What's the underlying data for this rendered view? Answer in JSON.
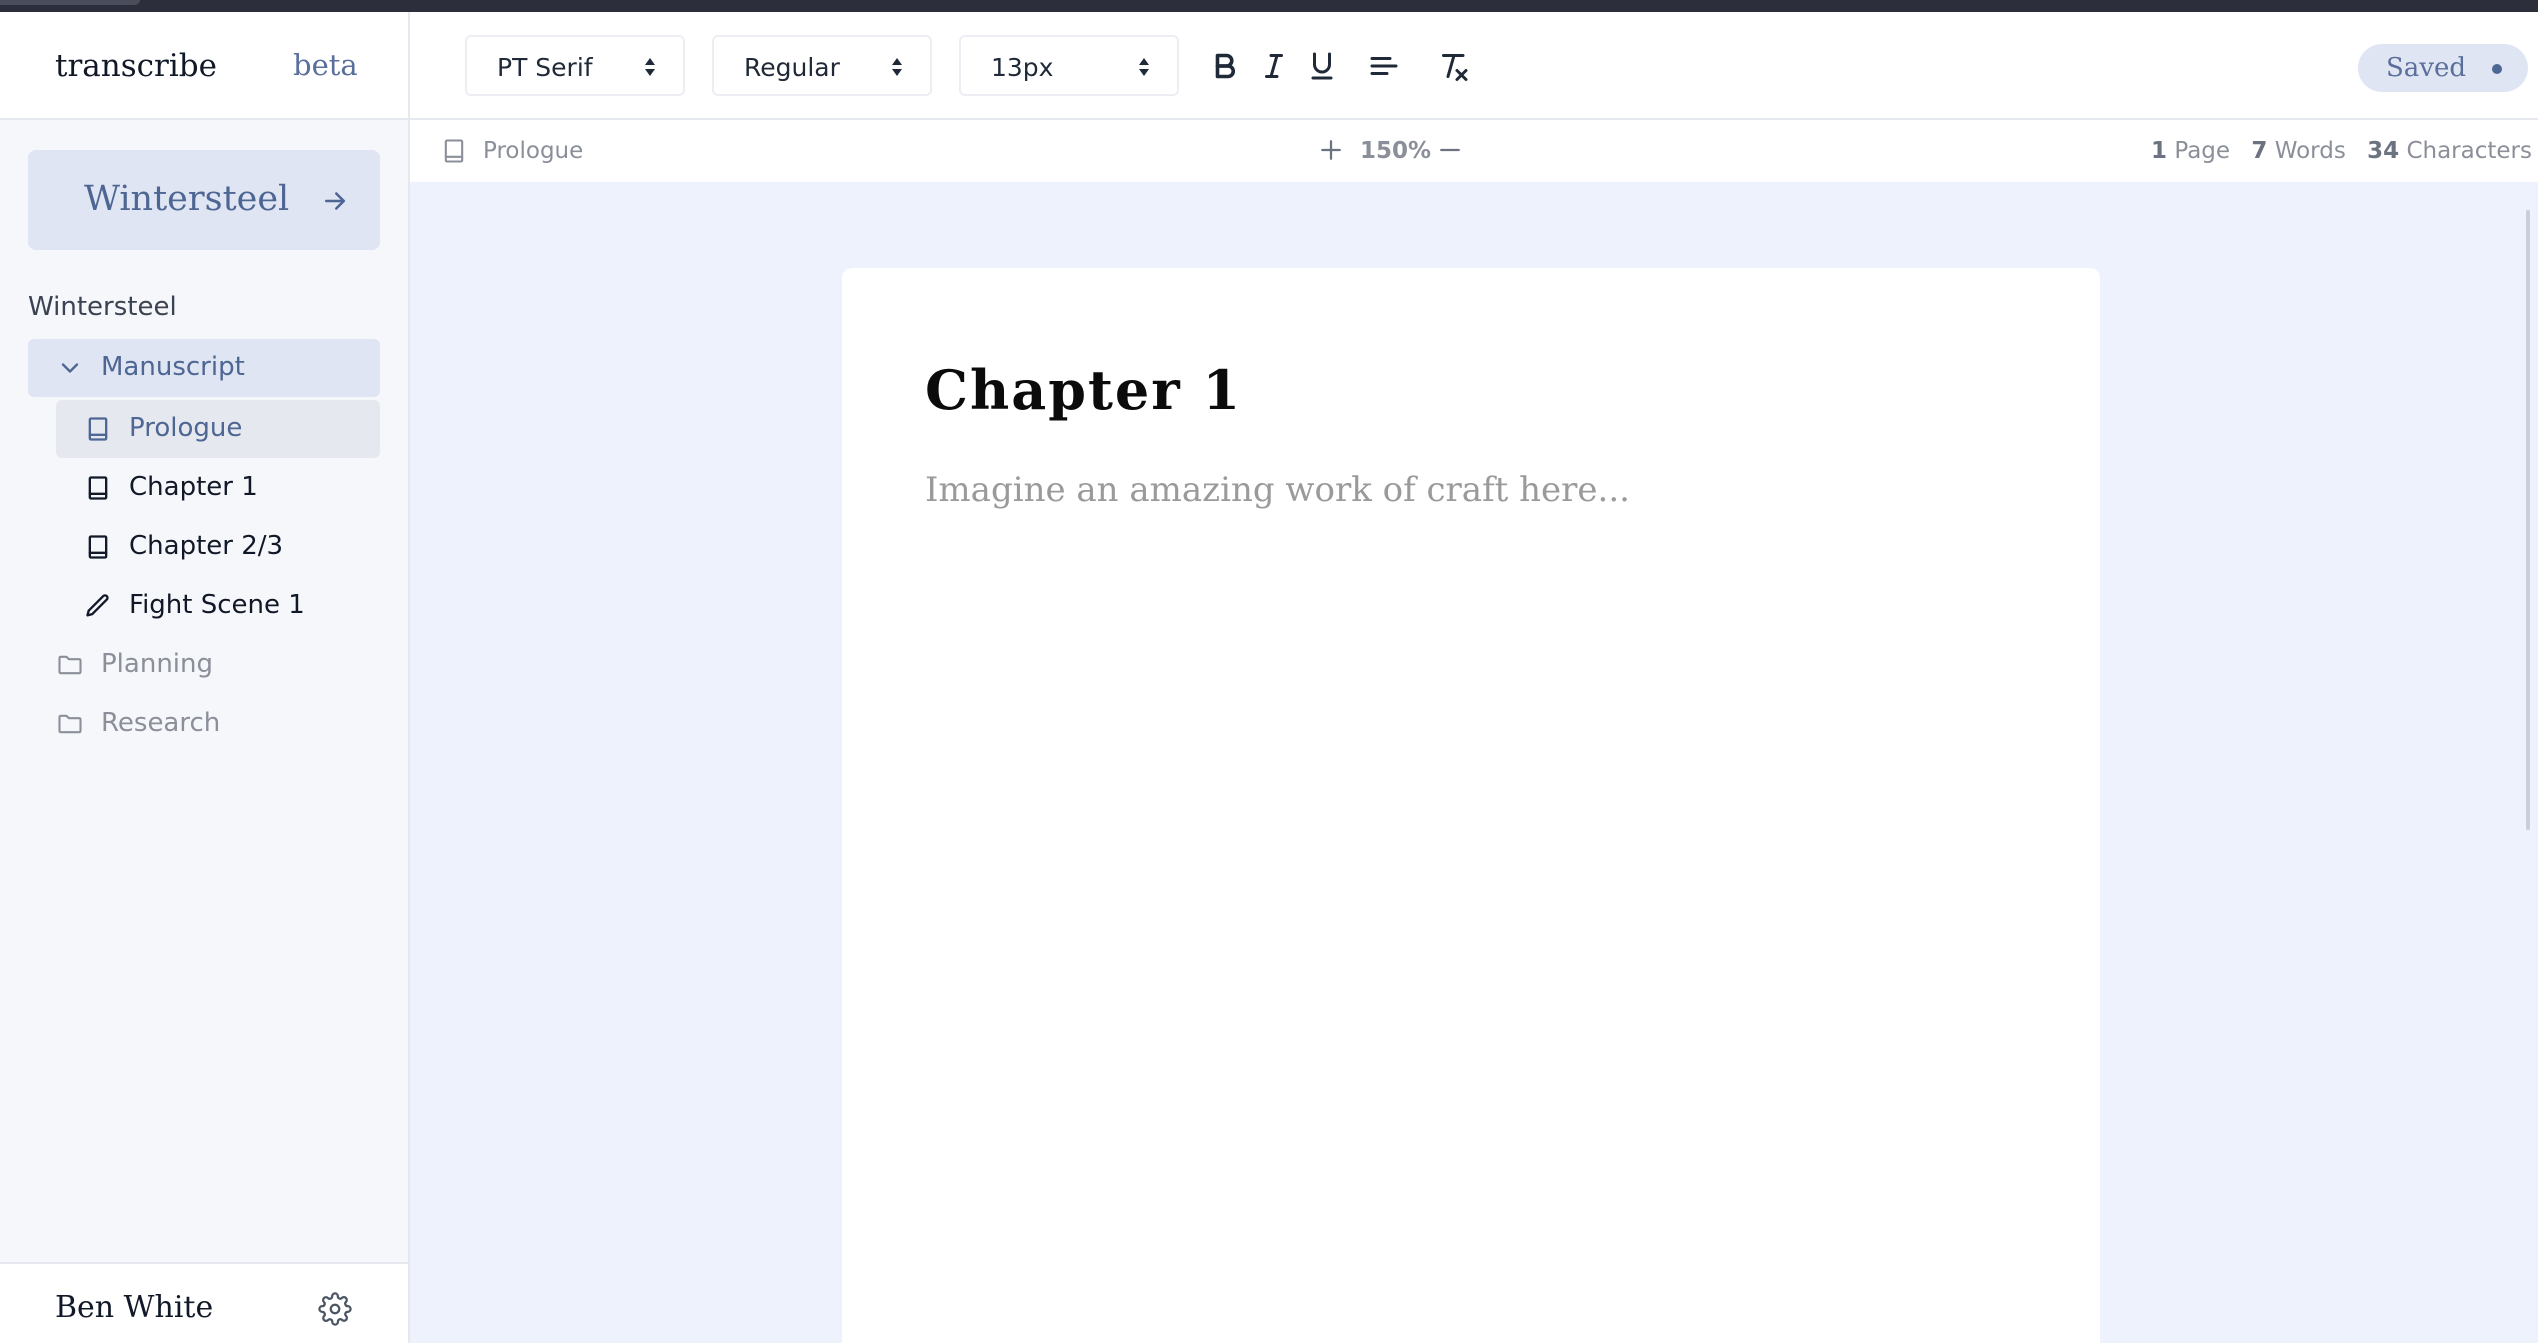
{
  "app": {
    "name": "transcribe",
    "badge": "beta"
  },
  "project": {
    "card_label": "Wintersteel",
    "title": "Wintersteel"
  },
  "tree": {
    "manuscript": {
      "label": "Manuscript",
      "icon": "chevron-down-icon"
    },
    "documents": [
      {
        "label": "Prologue",
        "icon": "book-icon",
        "active": true
      },
      {
        "label": "Chapter 1",
        "icon": "book-icon",
        "active": false
      },
      {
        "label": "Chapter 2/3",
        "icon": "book-icon",
        "active": false
      },
      {
        "label": "Fight Scene 1",
        "icon": "pencil-icon",
        "active": false
      }
    ],
    "folders": [
      {
        "label": "Planning",
        "icon": "folder-icon"
      },
      {
        "label": "Research",
        "icon": "folder-icon"
      }
    ]
  },
  "user": {
    "name": "Ben White"
  },
  "toolbar": {
    "font_family": "PT Serif",
    "font_weight": "Regular",
    "font_size": "13px",
    "status": "Saved"
  },
  "infobar": {
    "doc_name": "Prologue",
    "zoom": "150%",
    "pages_count": "1",
    "pages_label": "Page",
    "words_count": "7",
    "words_label": "Words",
    "chars_count": "34",
    "chars_label": "Characters"
  },
  "document": {
    "title": "Chapter 1",
    "placeholder": "Imagine an amazing work of craft here..."
  },
  "colors": {
    "accent": "#4e6694",
    "sidebar_bg": "#f6f7fb",
    "canvas_bg": "#eef2fc",
    "highlight": "#dfe5f2"
  }
}
